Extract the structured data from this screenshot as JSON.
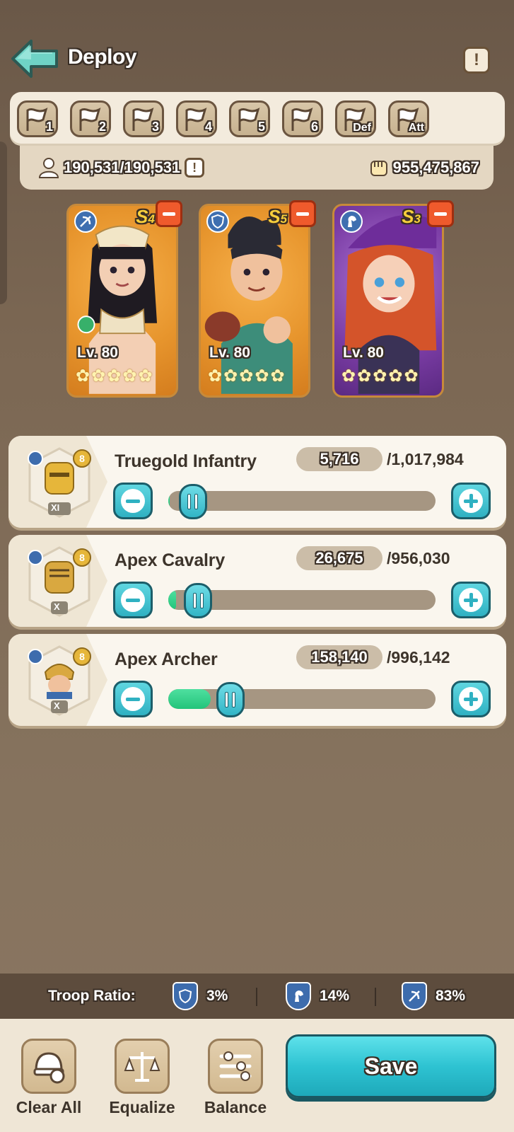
{
  "header": {
    "title": "Deploy"
  },
  "presets": [
    "1",
    "2",
    "3",
    "4",
    "5",
    "6",
    "Def",
    "Att"
  ],
  "resources": {
    "troops": "190,531/190,531",
    "power": "955,475,867"
  },
  "heroes": [
    {
      "grade": "S",
      "grade_num": "4",
      "level": "Lv. 80",
      "stars": 5,
      "type_icon": "archer-icon"
    },
    {
      "grade": "S",
      "grade_num": "5",
      "level": "Lv. 80",
      "stars": 5,
      "type_icon": "shield-icon"
    },
    {
      "grade": "S",
      "grade_num": "3",
      "level": "Lv. 80",
      "stars": 5,
      "type_icon": "horse-icon"
    }
  ],
  "troops": [
    {
      "name": "Truegold Infantry",
      "count": "5,716",
      "max": "/1,017,984",
      "tier": "XI",
      "fill_fraction": 0.0056,
      "thumb_fraction": 0.05
    },
    {
      "name": "Apex Cavalry",
      "count": "26,675",
      "max": "/956,030",
      "tier": "X",
      "fill_fraction": 0.028,
      "thumb_fraction": 0.07
    },
    {
      "name": "Apex Archer",
      "count": "158,140",
      "max": "/996,142",
      "tier": "X",
      "fill_fraction": 0.159,
      "thumb_fraction": 0.19
    }
  ],
  "ratio": {
    "label": "Troop Ratio:",
    "infantry": "3%",
    "cavalry": "14%",
    "archer": "83%"
  },
  "actions": {
    "clear_all": "Clear All",
    "equalize": "Equalize",
    "balance": "Balance",
    "save": "Save"
  },
  "colors": {
    "accent": "#2ec3d2",
    "remove": "#ef5a2c",
    "fill": "#22c47a"
  }
}
